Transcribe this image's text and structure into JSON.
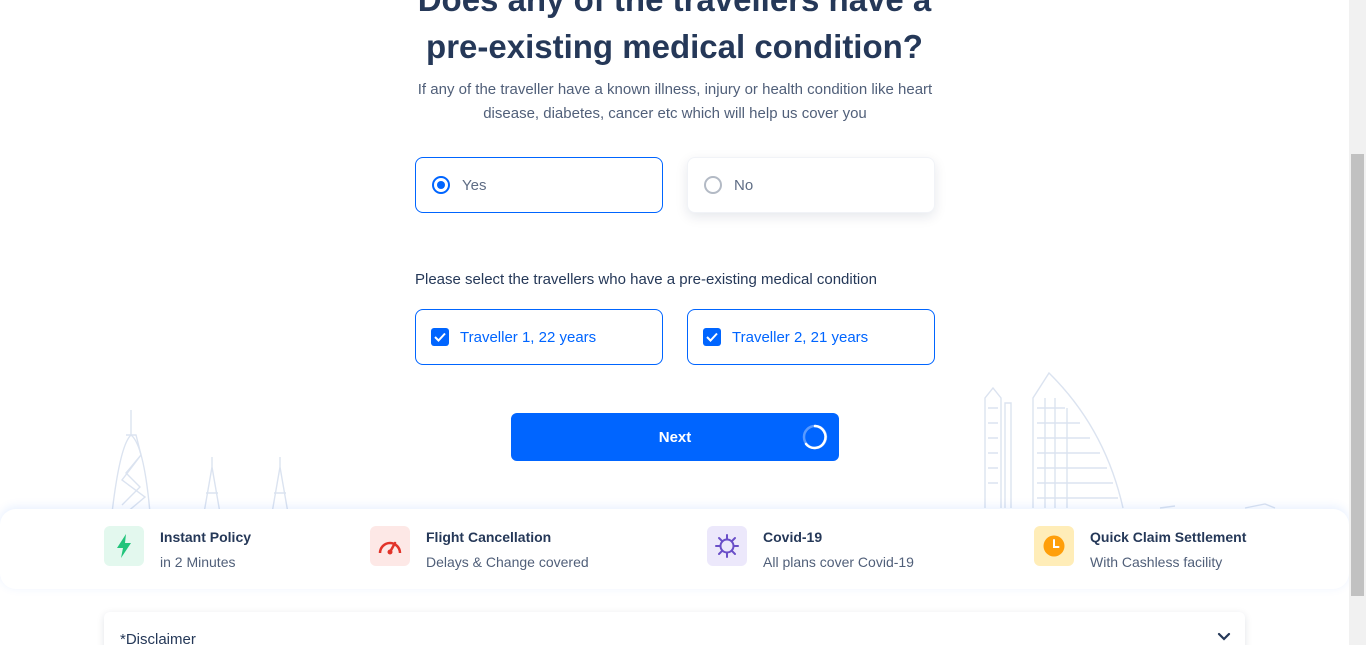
{
  "question": {
    "title_line1": "Does any of the travellers have a",
    "title_line2": "pre-existing medical condition?",
    "subtitle": "If any of the traveller have a known illness, injury or health condition like heart disease, diabetes, cancer etc which will help us cover you"
  },
  "options": {
    "yes_label": "Yes",
    "no_label": "No",
    "selected": "Yes"
  },
  "travellers": {
    "prompt": "Please select the travellers who have a pre-existing medical condition",
    "items": [
      {
        "label": "Traveller 1, 22 years",
        "checked": true
      },
      {
        "label": "Traveller 2, 21 years",
        "checked": true
      }
    ]
  },
  "next_button": {
    "label": "Next",
    "loading": true
  },
  "features": [
    {
      "title": "Instant Policy",
      "subtitle": "in 2 Minutes",
      "icon": "lightning-icon",
      "color": "#22c47b"
    },
    {
      "title": "Flight Cancellation",
      "subtitle": "Delays & Change covered",
      "icon": "speedometer-icon",
      "color": "#e2342a"
    },
    {
      "title": "Covid-19",
      "subtitle": "All plans cover Covid-19",
      "icon": "virus-icon",
      "color": "#6a4fc8"
    },
    {
      "title": "Quick Claim Settlement",
      "subtitle": "With Cashless facility",
      "icon": "clock-icon",
      "color": "#ff9f0a"
    }
  ],
  "disclaimer": {
    "label": "*Disclaimer"
  },
  "colors": {
    "primary": "#0065ff",
    "heading": "#253858"
  }
}
